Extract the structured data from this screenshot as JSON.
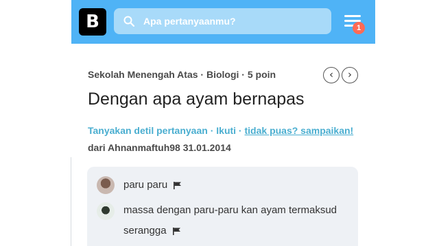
{
  "header": {
    "logo_letter": "B",
    "search": {
      "placeholder": "Apa pertanyaanmu?"
    },
    "notifications": {
      "count": "1"
    }
  },
  "question": {
    "meta": "Sekolah Menengah Atas · Biologi · 5 poin",
    "title": "Dengan apa ayam bernapas",
    "actions": {
      "ask_detail": "Tanyakan detil pertanyaan",
      "separator": " · ",
      "follow": "Ikuti",
      "report": "tidak puas? sampaikan!"
    },
    "author_line": "dari Ahnanmaftuh98 31.01.2014"
  },
  "comments": [
    {
      "text": "paru paru"
    },
    {
      "text": "massa dengan paru-paru kan ayam termaksud serangga"
    }
  ],
  "colors": {
    "topbar": "#4fb3f6",
    "search_bg": "#a8daf9",
    "link": "#4aaed0",
    "badge": "#ff6a55",
    "comment_bg": "#eef1f5"
  }
}
